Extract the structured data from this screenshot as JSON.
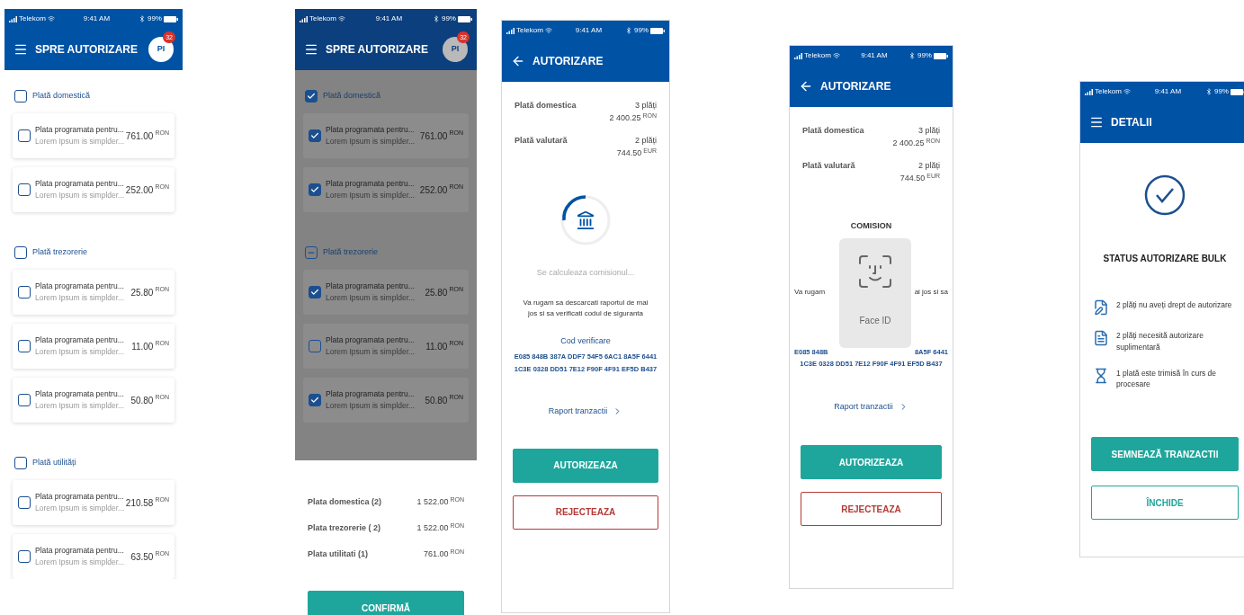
{
  "screens": [
    {
      "kind": "selection",
      "dimmed": false,
      "status_bar": {
        "carrier": "Telekom",
        "time": "9:41 AM",
        "battery": "99%"
      },
      "header": {
        "back": false,
        "title": "SPRE AUTORIZARE"
      },
      "avatar": {
        "initials": "PI",
        "badge": "32"
      },
      "groups": [
        {
          "label": "Plată domestică",
          "checked": false,
          "partial": false,
          "items": [
            {
              "title": "Plata programata pentru...",
              "subtitle": "Lorem Ipsum is simplder...",
              "amount": "761.00",
              "currency": "RON",
              "checked": false
            },
            {
              "title": "Plata programata pentru...",
              "subtitle": "Lorem Ipsum is simplder...",
              "amount": "252.00",
              "currency": "RON",
              "checked": false
            }
          ]
        },
        {
          "label": "Plată trezorerie",
          "checked": false,
          "partial": false,
          "items": [
            {
              "title": "Plata programata pentru...",
              "subtitle": "Lorem Ipsum is simplder...",
              "amount": "25.80",
              "currency": "RON",
              "checked": false
            },
            {
              "title": "Plata programata pentru...",
              "subtitle": "Lorem Ipsum is simplder...",
              "amount": "11.00",
              "currency": "RON",
              "checked": false
            },
            {
              "title": "Plata programata pentru...",
              "subtitle": "Lorem Ipsum is simplder...",
              "amount": "50.80",
              "currency": "RON",
              "checked": false
            }
          ]
        },
        {
          "label": "Plată utilități",
          "checked": false,
          "partial": false,
          "items": [
            {
              "title": "Plata programata pentru...",
              "subtitle": "Lorem Ipsum is simplder...",
              "amount": "210.58",
              "currency": "RON",
              "checked": false
            },
            {
              "title": "Plata programata pentru...",
              "subtitle": "Lorem Ipsum is simplder...",
              "amount": "63.50",
              "currency": "RON",
              "checked": false
            }
          ]
        }
      ]
    },
    {
      "kind": "selection",
      "dimmed": true,
      "status_bar": {
        "carrier": "Telekom",
        "time": "9:41 AM",
        "battery": "99%"
      },
      "header": {
        "back": false,
        "title": "SPRE AUTORIZARE"
      },
      "avatar": {
        "initials": "PI",
        "badge": "32"
      },
      "groups": [
        {
          "label": "Plată domestică",
          "checked": true,
          "partial": false,
          "items": [
            {
              "title": "Plata programata pentru...",
              "subtitle": "Lorem Ipsum is simplder...",
              "amount": "761.00",
              "currency": "RON",
              "checked": true
            },
            {
              "title": "Plata programata pentru...",
              "subtitle": "Lorem Ipsum is simplder...",
              "amount": "252.00",
              "currency": "RON",
              "checked": true
            }
          ]
        },
        {
          "label": "Plată trezorerie",
          "checked": false,
          "partial": true,
          "items": [
            {
              "title": "Plata programata pentru...",
              "subtitle": "Lorem Ipsum is simplder...",
              "amount": "25.80",
              "currency": "RON",
              "checked": true
            },
            {
              "title": "Plata programata pentru...",
              "subtitle": "Lorem Ipsum is simplder...",
              "amount": "11.00",
              "currency": "RON",
              "checked": false
            },
            {
              "title": "Plata programata pentru...",
              "subtitle": "Lorem Ipsum is simplder...",
              "amount": "50.80",
              "currency": "RON",
              "checked": true
            }
          ]
        }
      ],
      "summary": [
        {
          "label": "Plata domestica (2)",
          "amount": "1 522.00",
          "currency": "RON"
        },
        {
          "label": "Plata trezorerie ( 2)",
          "amount": "1 522.00",
          "currency": "RON"
        },
        {
          "label": "Plata utilitati (1)",
          "amount": "761.00",
          "currency": "RON"
        }
      ],
      "buttons": [
        {
          "kind": "primary",
          "label": "CONFIRMĂ"
        }
      ]
    },
    {
      "kind": "authorize",
      "status_bar": {
        "carrier": "Telekom",
        "time": "9:41 AM",
        "battery": "99%"
      },
      "header": {
        "back": true,
        "title": "AUTORIZARE"
      },
      "payments": [
        {
          "label": "Plată domestica",
          "count": "3 plăți",
          "amount": "2 400.25",
          "currency": "RON"
        },
        {
          "label": "Plată valutară",
          "count": "2 plăți",
          "amount": "744.50",
          "currency": "EUR"
        }
      ],
      "loading": {
        "text": "Se calculeaza comisionul..."
      },
      "message_parts": [
        "Va rugam sa descarcati raportul de mai jos si sa verificati codul de siguranta"
      ],
      "code_label": "Cod verificare",
      "code_lines": [
        [
          "E085 848B 387A DDF7 54F5 6AC1 8A5F 6441"
        ],
        [
          "1C3E 0328 DD51 7E12 F90F 4F91 EF5D B437"
        ]
      ],
      "link": "Raport tranzactii",
      "buttons": [
        {
          "kind": "primary",
          "label": "AUTORIZEAZA"
        },
        {
          "kind": "reject",
          "label": "REJECTEAZA"
        }
      ]
    },
    {
      "kind": "authorize",
      "status_bar": {
        "carrier": "Telekom",
        "time": "9:41 AM",
        "battery": "99%"
      },
      "header": {
        "back": true,
        "title": "AUTORIZARE"
      },
      "payments": [
        {
          "label": "Plată domestica",
          "count": "3 plăți",
          "amount": "2 400.25",
          "currency": "RON"
        },
        {
          "label": "Plată valutară",
          "count": "2 plăți",
          "amount": "744.50",
          "currency": "EUR"
        }
      ],
      "section_title": "COMISION",
      "message_parts": [
        "Va rugam",
        "ai jos si sa"
      ],
      "code_lines": [
        [
          "E085 848B",
          "8A5F 6441"
        ],
        [
          "1C3E 0328 DD51 7E12 F90F 4F91 EF5D B437"
        ]
      ],
      "face_id": {
        "label": "Face ID"
      },
      "link": "Raport tranzactii",
      "buttons": [
        {
          "kind": "primary",
          "label": "AUTORIZEAZA"
        },
        {
          "kind": "reject",
          "label": "REJECTEAZA"
        }
      ]
    },
    {
      "kind": "details",
      "status_bar": {
        "carrier": "Telekom",
        "time": "9:41 AM",
        "battery": "99%"
      },
      "header": {
        "back": false,
        "title": "DETALII"
      },
      "title": "STATUS AUTORIZARE BULK",
      "items": [
        {
          "kind": "signed-document",
          "text": "2 plăți nu aveți drept de autorizare"
        },
        {
          "kind": "document",
          "text": "2 plăți necesită autorizare suplimentară"
        },
        {
          "kind": "hourglass",
          "text": "1 plată este trimisă în curs de procesare"
        }
      ],
      "buttons": [
        {
          "kind": "primary",
          "label": "SEMNEAZĂ TRANZACTII"
        },
        {
          "kind": "outline",
          "label": "ÎNCHIDE"
        }
      ]
    }
  ]
}
